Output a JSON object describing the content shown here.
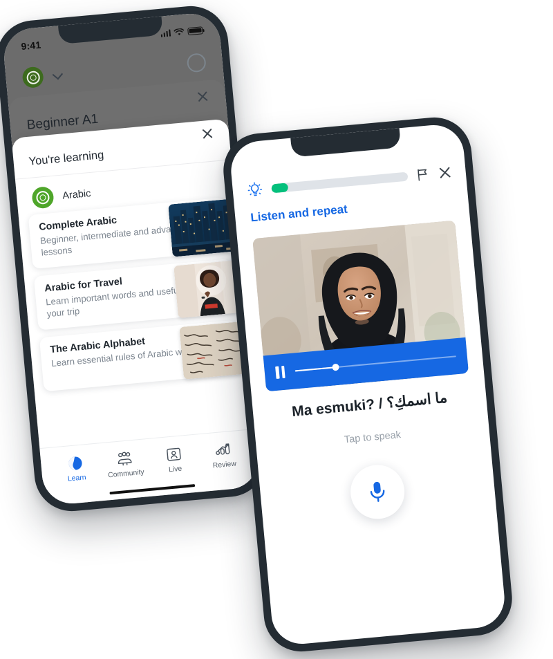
{
  "theme": {
    "brand_blue": "#1668e3",
    "brand_green": "#04c07c",
    "logo_green": "#4fa62a",
    "bezel": "#242c33",
    "muted_text": "#7e8791"
  },
  "left_phone": {
    "status_bar": {
      "time": "9:41",
      "signal_icon": "cellular-signal-icon",
      "wifi_icon": "wifi-icon",
      "battery_icon": "battery-icon"
    },
    "app_bar": {
      "logo_icon": "busuu-logo-icon",
      "language_selector_icon": "chevron-down-icon",
      "progress_ring_icon": "progress-ring-icon"
    },
    "level_sheet": {
      "title": "Beginner A1",
      "close_icon": "close-icon"
    },
    "learning_sheet": {
      "title": "You're learning",
      "close_icon": "close-icon",
      "language": {
        "name": "Arabic",
        "badge_icon": "arabic-language-badge-icon"
      },
      "courses": [
        {
          "title": "Complete Arabic",
          "subtitle": "Beginner, intermediate and advanced lessons",
          "thumb": "dubai-skyline-night-photo"
        },
        {
          "title": "Arabic for Travel",
          "subtitle": "Learn important words and useful phrases for your trip",
          "thumb": "woman-speaking-photo"
        },
        {
          "title": "The Arabic Alphabet",
          "subtitle": "Learn essential rules of Arabic writing",
          "thumb": "arabic-calligraphy-photo"
        }
      ]
    },
    "tab_bar": {
      "items": [
        {
          "label": "Learn",
          "icon": "globe-icon",
          "active": true
        },
        {
          "label": "Community",
          "icon": "community-people-icon",
          "active": false
        },
        {
          "label": "Live",
          "icon": "live-video-person-icon",
          "active": false
        },
        {
          "label": "Review",
          "icon": "review-chart-arrow-icon",
          "active": false
        }
      ]
    }
  },
  "right_phone": {
    "lesson_header": {
      "hint_icon": "lightbulb-icon",
      "progress_percent": 12,
      "report_icon": "flag-icon",
      "close_icon": "close-icon"
    },
    "kicker": "Listen and repeat",
    "media": {
      "image": "smiling-woman-in-hijab-photo",
      "player": {
        "state_icon": "pause-icon",
        "scrub_percent": 25
      }
    },
    "phrase": "Ma esmuki? / ما اسمكِ؟",
    "tap_hint": "Tap to speak",
    "mic_button_icon": "microphone-icon"
  }
}
